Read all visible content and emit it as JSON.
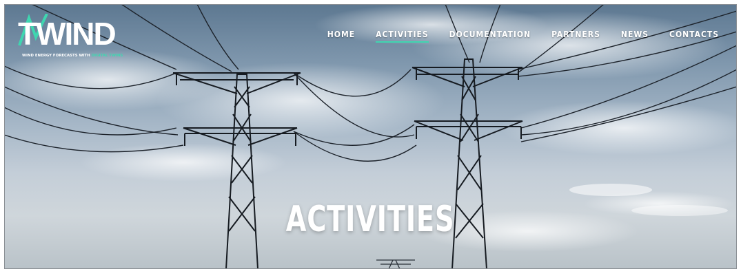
{
  "brand": {
    "logo_text": "TWIND",
    "tagline_main": "WIND ENERGY FORECASTS WITH",
    "tagline_accent": "DIGITAL TWINS",
    "accent_color": "#3fd6b0"
  },
  "nav": {
    "items": [
      {
        "label": "HOME",
        "active": false
      },
      {
        "label": "ACTIVITIES",
        "active": true
      },
      {
        "label": "DOCUMENTATION",
        "active": false
      },
      {
        "label": "PARTNERS",
        "active": false
      },
      {
        "label": "NEWS",
        "active": false
      },
      {
        "label": "CONTACTS",
        "active": false
      }
    ]
  },
  "hero": {
    "title": "ACTIVITIES",
    "background": "power-pylons-sky-photo"
  }
}
